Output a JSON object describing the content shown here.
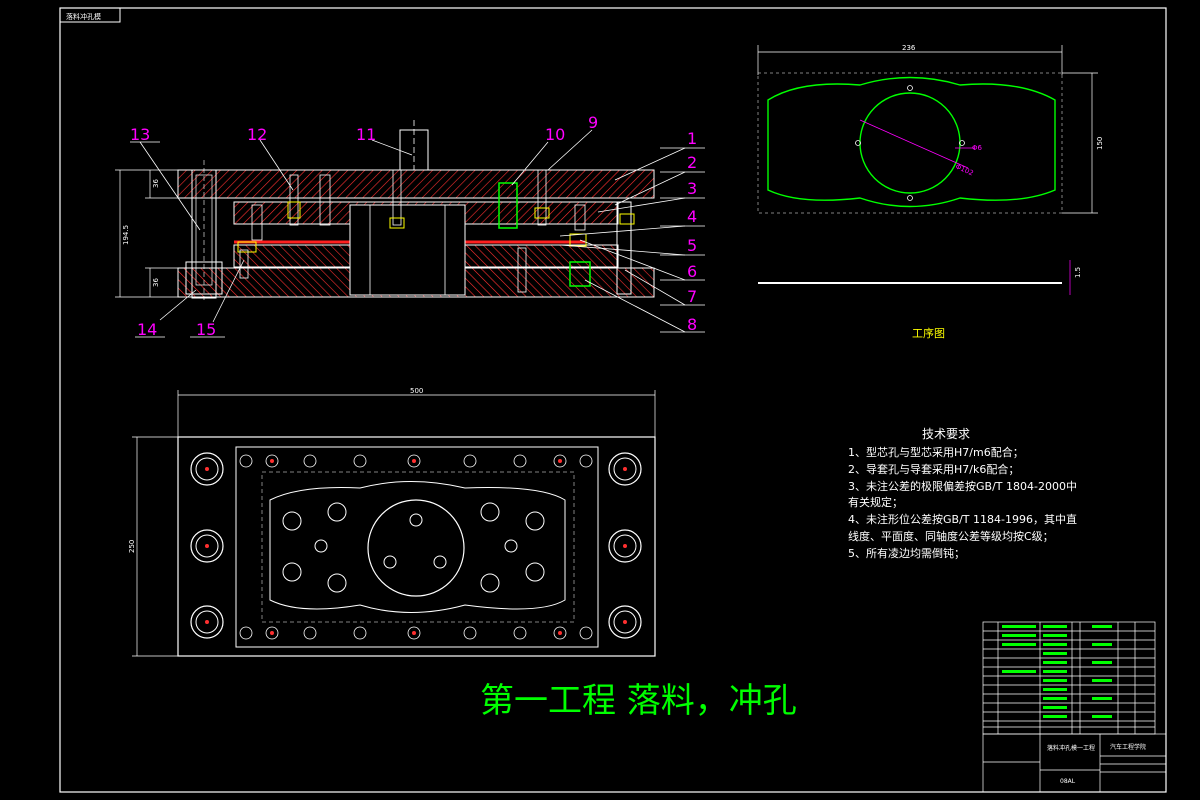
{
  "colors": {
    "background": "#000000",
    "outline": "#ffffff",
    "balloon": "#ff00ff",
    "part_hatch": "#ff0000",
    "hidden_green": "#00ff00",
    "detail_yellow": "#ffff00",
    "dimension": "#ff00ff"
  },
  "drawing_tag": "落料冲孔模",
  "section_view": {
    "balloons": [
      "1",
      "2",
      "3",
      "4",
      "5",
      "6",
      "7",
      "8",
      "9",
      "10",
      "11",
      "12",
      "13",
      "14",
      "15"
    ],
    "dims": {
      "overall_height": "194.5",
      "upper_thickness": "36",
      "lower_thickness": "36"
    }
  },
  "workpiece": {
    "caption": "工序图",
    "dims": {
      "length": "236",
      "width": "150",
      "thickness": "1.5",
      "hole_dia": "Φ102",
      "small_hole": "Φ6"
    }
  },
  "plan_view": {
    "dims": {
      "length": "500",
      "width": "250"
    }
  },
  "technical_requirements": {
    "heading": "技术要求",
    "items": [
      "1、型芯孔与型芯采用H7/m6配合；",
      "2、导套孔与导套采用H7/k6配合；",
      "3、未注公差的极限偏差按GB/T 1804-2000中",
      "     有关规定；",
      "4、未注形位公差按GB/T 1184-1996，其中直",
      "     线度、平面度、同轴度公差等级均按C级；",
      "5、所有凌边均需倒钝；"
    ]
  },
  "process_title": "第一工程   落料，冲孔",
  "title_block": {
    "drawing_name": "落料冲孔模一工程",
    "school": "汽车工程学院",
    "material": "08AL"
  }
}
